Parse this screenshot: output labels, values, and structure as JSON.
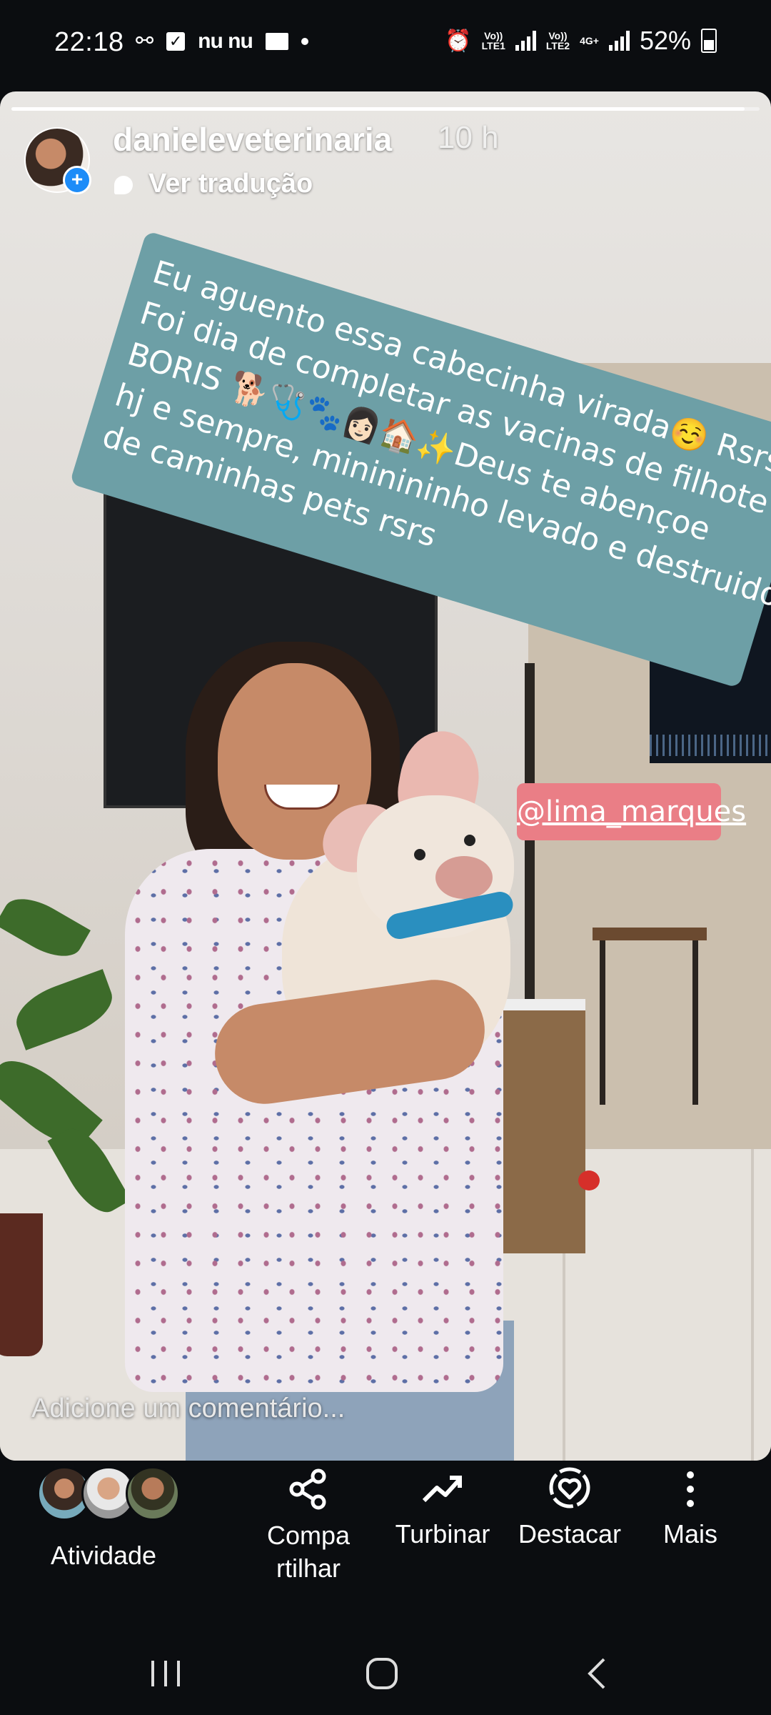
{
  "status_bar": {
    "time": "22:18",
    "nu_label": "nu nu",
    "sim1_label": "Vo))\nLTE1",
    "sim2_label": "Vo))\nLTE2",
    "net2_type": "4G+",
    "battery": "52%"
  },
  "story": {
    "username": "danieleveterinaria",
    "time_ago": "10 h",
    "translate_label": "Ver tradução",
    "progress": 0.98,
    "caption_lines": [
      "Eu aguento essa cabecinha virada☺️ Rsrs",
      "Foi dia de completar as vacinas de filhote do",
      "BORIS 🐕🩺🐾👩🏻🏠✨Deus te abençoe",
      "hj e sempre, mininininho levado e destruidor",
      "de   caminhas pets rsrs"
    ],
    "mention": "@lima_marques",
    "comment_placeholder": "Adicione um comentário..."
  },
  "actions": {
    "activity": "Atividade",
    "share": "Compa\nrtilhar",
    "boost": "Turbinar",
    "highlight": "Destacar",
    "more": "Mais"
  },
  "colors": {
    "caption_bg": "#6d9fa6",
    "mention_bg": "#ea7e86",
    "plus_badge": "#1d8cf8"
  }
}
